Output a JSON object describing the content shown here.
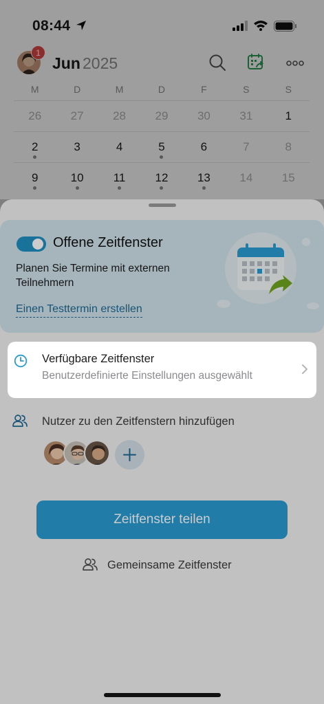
{
  "status": {
    "time": "08:44"
  },
  "header": {
    "month": "Jun",
    "year": "2025",
    "badge": "1"
  },
  "calendar": {
    "weekdays": [
      "M",
      "D",
      "M",
      "D",
      "F",
      "S",
      "S"
    ],
    "rows": [
      {
        "days": [
          "26",
          "27",
          "28",
          "29",
          "30",
          "31",
          "1"
        ],
        "muted": [
          true,
          true,
          true,
          true,
          true,
          true,
          false
        ],
        "dots": [
          false,
          false,
          false,
          false,
          false,
          false,
          false
        ]
      },
      {
        "days": [
          "2",
          "3",
          "4",
          "5",
          "6",
          "7",
          "8"
        ],
        "muted": [
          false,
          false,
          false,
          false,
          false,
          true,
          true
        ],
        "dots": [
          true,
          false,
          false,
          true,
          false,
          false,
          false
        ]
      },
      {
        "days": [
          "9",
          "10",
          "11",
          "12",
          "13",
          "14",
          "15"
        ],
        "muted": [
          false,
          false,
          false,
          false,
          false,
          true,
          true
        ],
        "dots": [
          true,
          true,
          true,
          true,
          true,
          false,
          false
        ]
      }
    ]
  },
  "sheet": {
    "promo": {
      "title": "Offene Zeitfenster",
      "text": "Planen Sie Termine mit externen Teilnehmern",
      "link": "Einen Testtermin erstellen",
      "toggle_on": true
    },
    "available": {
      "title": "Verfügbare Zeitfenster",
      "subtitle": "Benutzerdefinierte Einstellungen ausgewählt"
    },
    "users": {
      "label": "Nutzer zu den Zeitfenstern hinzufügen"
    },
    "share_button": "Zeitfenster teilen",
    "common": "Gemeinsame Zeitfenster"
  },
  "colors": {
    "accent": "#2a9bd3",
    "link": "#1f6a96",
    "badge": "#e34a4a",
    "promo_bg": "#cfe3ea"
  },
  "icons": [
    "location-arrow-icon",
    "signal-icon",
    "wifi-icon",
    "battery-icon",
    "search-icon",
    "calendar-share-icon",
    "more-icon",
    "clock-icon",
    "chevron-right-icon",
    "users-icon",
    "plus-icon",
    "people-icon"
  ]
}
